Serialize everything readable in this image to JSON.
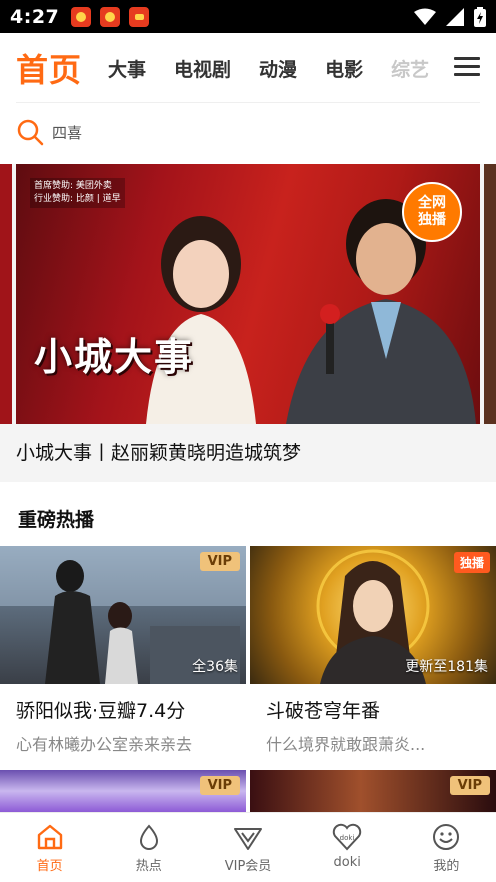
{
  "status_bar": {
    "time": "4:27"
  },
  "tabs": {
    "home": "首页",
    "items": [
      "大事",
      "电视剧",
      "动漫",
      "电影",
      "综艺"
    ]
  },
  "search": {
    "placeholder": "四喜"
  },
  "hero": {
    "credit_line1": "首席赞助: 美团外卖",
    "credit_line2": "行业赞助: 比颜 | 道早",
    "art_title": "小城大事",
    "badge": "全网\n独播",
    "caption": "小城大事丨赵丽颖黄晓明造城筑梦"
  },
  "section": {
    "title": "重磅热播"
  },
  "cards": [
    {
      "title": "骄阳似我·豆瓣7.4分",
      "subtitle": "心有林曦办公室亲来亲去",
      "badge": "VIP",
      "episode": "全36集"
    },
    {
      "title": "斗破苍穹年番",
      "subtitle": "什么境界就敢跟萧炎...",
      "badge": "独播",
      "episode": "更新至181集"
    },
    {
      "title": "",
      "subtitle": "",
      "badge": "VIP",
      "episode": ""
    },
    {
      "title": "",
      "subtitle": "",
      "badge": "VIP",
      "episode": ""
    }
  ],
  "bottom_nav": [
    {
      "label": "首页",
      "icon": "home-icon",
      "active": true
    },
    {
      "label": "热点",
      "icon": "flame-icon",
      "active": false
    },
    {
      "label": "VIP会员",
      "icon": "vip-icon",
      "active": false
    },
    {
      "label": "doki",
      "icon": "doki-heart-icon",
      "active": false
    },
    {
      "label": "我的",
      "icon": "smiley-icon",
      "active": false
    }
  ],
  "colors": {
    "accent": "#ff6a13",
    "vip_gold": "#f0c27a",
    "exclusive": "#ff5a1f"
  }
}
